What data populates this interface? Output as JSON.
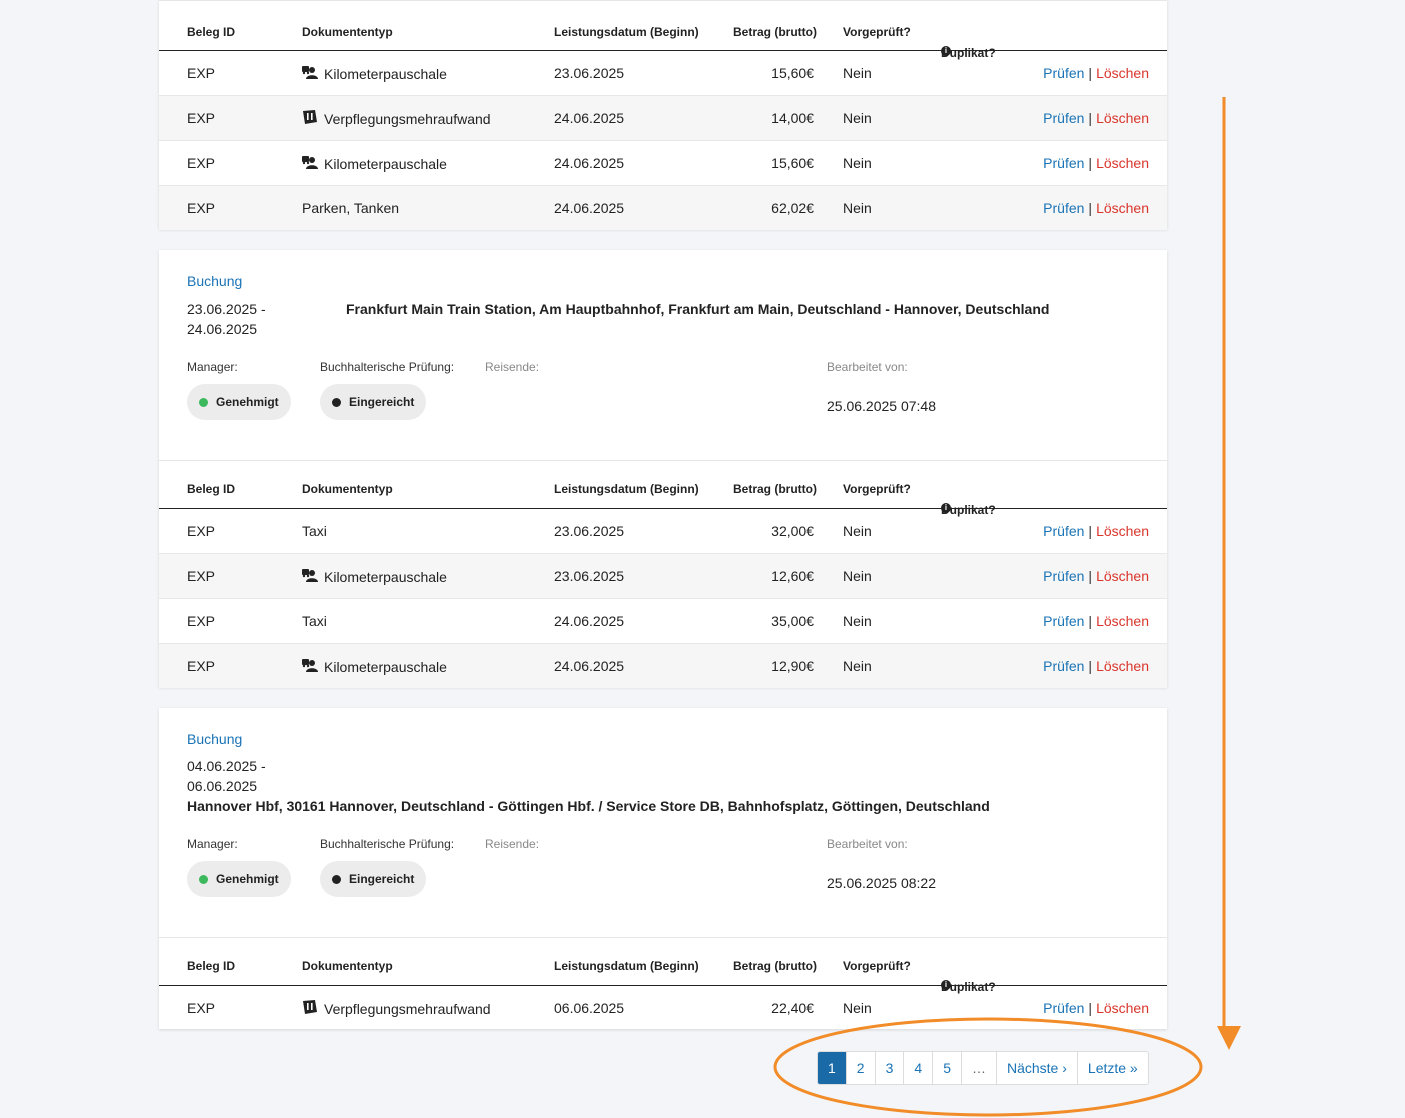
{
  "table_headers": {
    "id": "Beleg ID",
    "type": "Dokumententyp",
    "date": "Leistungsdatum (Beginn)",
    "amount": "Betrag (brutto)",
    "prechecked": "Vorgeprüft?",
    "duplicate": "Duplikat?"
  },
  "actions": {
    "check": "Prüfen",
    "separator": "|",
    "delete": "Löschen"
  },
  "top_table": {
    "rows": [
      {
        "id": "EXP",
        "type": "Kilometerpauschale",
        "icon": "car-people-icon",
        "date": "23.06.2025",
        "amount": "15,60€",
        "prechecked": "Nein"
      },
      {
        "id": "EXP",
        "type": "Verpflegungsmehraufwand",
        "icon": "meal-receipt-icon",
        "date": "24.06.2025",
        "amount": "14,00€",
        "prechecked": "Nein"
      },
      {
        "id": "EXP",
        "type": "Kilometerpauschale",
        "icon": "car-people-icon",
        "date": "24.06.2025",
        "amount": "15,60€",
        "prechecked": "Nein"
      },
      {
        "id": "EXP",
        "type": "Parken, Tanken",
        "icon": "",
        "date": "24.06.2025",
        "amount": "62,02€",
        "prechecked": "Nein"
      }
    ]
  },
  "booking1": {
    "label": "Buchung",
    "date_start": "23.06.2025 -",
    "date_end": "24.06.2025",
    "route": "Frankfurt Main Train Station, Am Hauptbahnhof, Frankfurt am Main, Deutschland - Hannover, Deutschland",
    "manager_label": "Manager:",
    "manager_status": "Genehmigt",
    "accounting_label": "Buchhalterische Prüfung:",
    "accounting_status": "Eingereicht",
    "travelers_label": "Reisende:",
    "edited_label": "Bearbeitet von:",
    "edited_value": "25.06.2025 07:48",
    "rows": [
      {
        "id": "EXP",
        "type": "Taxi",
        "icon": "",
        "date": "23.06.2025",
        "amount": "32,00€",
        "prechecked": "Nein"
      },
      {
        "id": "EXP",
        "type": "Kilometerpauschale",
        "icon": "car-people-icon",
        "date": "23.06.2025",
        "amount": "12,60€",
        "prechecked": "Nein"
      },
      {
        "id": "EXP",
        "type": "Taxi",
        "icon": "",
        "date": "24.06.2025",
        "amount": "35,00€",
        "prechecked": "Nein"
      },
      {
        "id": "EXP",
        "type": "Kilometerpauschale",
        "icon": "car-people-icon",
        "date": "24.06.2025",
        "amount": "12,90€",
        "prechecked": "Nein"
      }
    ]
  },
  "booking2": {
    "label": "Buchung",
    "date_start": "04.06.2025 -",
    "date_end": "06.06.2025",
    "route": "Hannover Hbf, 30161 Hannover, Deutschland - Göttingen Hbf. / Service Store DB, Bahnhofsplatz, Göttingen, Deutschland",
    "manager_label": "Manager:",
    "manager_status": "Genehmigt",
    "accounting_label": "Buchhalterische Prüfung:",
    "accounting_status": "Eingereicht",
    "travelers_label": "Reisende:",
    "edited_label": "Bearbeitet von:",
    "edited_value": "25.06.2025 08:22",
    "rows": [
      {
        "id": "EXP",
        "type": "Verpflegungsmehraufwand",
        "icon": "meal-receipt-icon",
        "date": "06.06.2025",
        "amount": "22,40€",
        "prechecked": "Nein"
      }
    ]
  },
  "pagination": {
    "pages": [
      "1",
      "2",
      "3",
      "4",
      "5"
    ],
    "ellipsis": "…",
    "next": "Nächste ›",
    "last": "Letzte »",
    "active": "1"
  },
  "colors": {
    "link": "#1a73b5",
    "delete": "#d9352b",
    "approved_dot": "#3cb95c",
    "submitted_dot": "#222222",
    "annotation": "#f28c28"
  }
}
